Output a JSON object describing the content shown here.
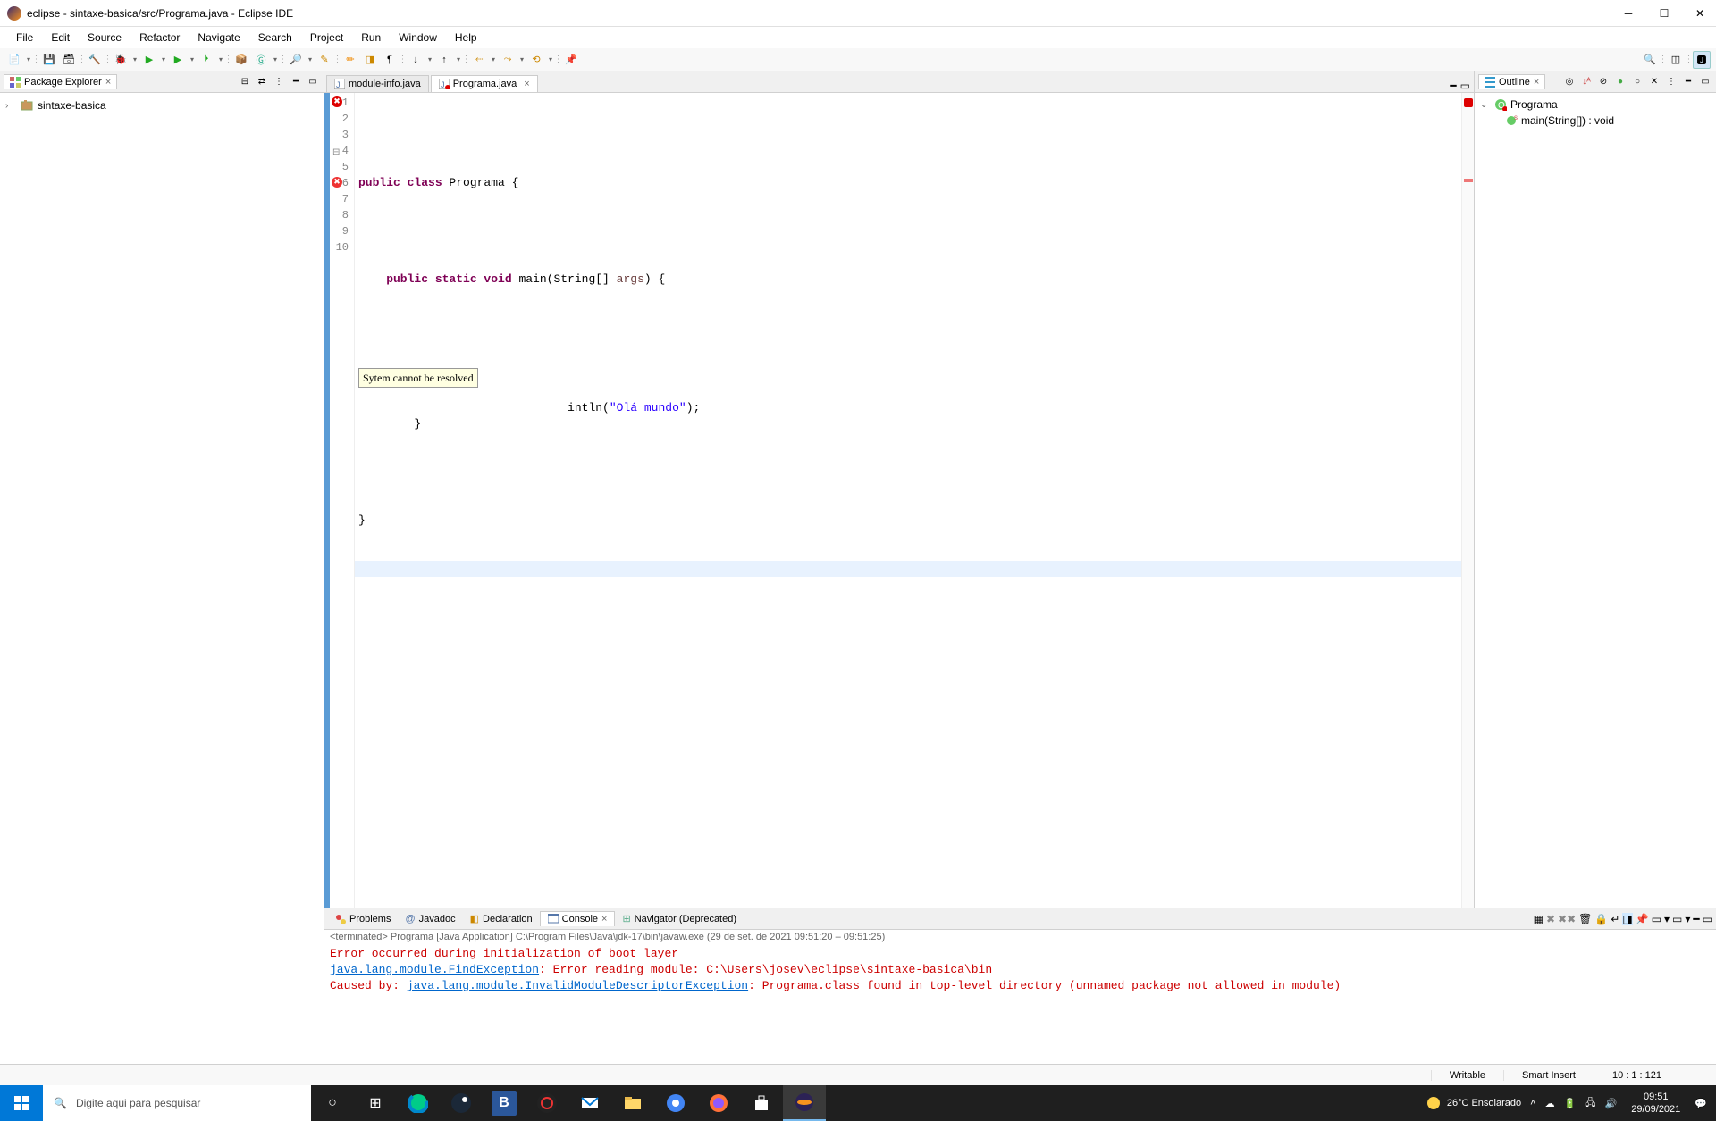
{
  "window": {
    "title": "eclipse - sintaxe-basica/src/Programa.java - Eclipse IDE"
  },
  "menu": {
    "items": [
      "File",
      "Edit",
      "Source",
      "Refactor",
      "Navigate",
      "Search",
      "Project",
      "Run",
      "Window",
      "Help"
    ]
  },
  "packageExplorer": {
    "title": "Package Explorer",
    "project": "sintaxe-basica"
  },
  "editor": {
    "tabs": [
      {
        "label": "module-info.java",
        "active": false
      },
      {
        "label": "Programa.java",
        "active": true
      }
    ],
    "code": {
      "line1": "",
      "line2_pre": "public class ",
      "line2_class": "Programa",
      "line2_post": " {",
      "line3": "",
      "line4_a": "    public static void",
      "line4_b": " main(String[] ",
      "line4_c": "args",
      "line4_d": ") {",
      "line5": "",
      "line6_tooltip": "Sytem cannot be resolved",
      "line6_after": "intln(",
      "line6_str": "\"Olá mundo\"",
      "line6_end": ");",
      "line7": "        }",
      "line8": "",
      "line9": "}",
      "line10": ""
    },
    "lineNumbers": [
      "1",
      "2",
      "3",
      "4",
      "5",
      "6",
      "7",
      "8",
      "9",
      "10"
    ]
  },
  "outline": {
    "title": "Outline",
    "class": "Programa",
    "method": "main(String[]) : void"
  },
  "bottom": {
    "tabs": {
      "problems": "Problems",
      "javadoc": "Javadoc",
      "declaration": "Declaration",
      "console": "Console",
      "navigator": "Navigator (Deprecated)"
    },
    "consoleMeta": "<terminated> Programa [Java Application] C:\\Program Files\\Java\\jdk-17\\bin\\javaw.exe  (29 de set. de 2021 09:51:20 – 09:51:25)",
    "consoleLines": {
      "l1": "Error occurred during initialization of boot layer",
      "l2a": "java.lang.module.FindException",
      "l2b": ": Error reading module: C:\\Users\\josev\\eclipse\\sintaxe-basica\\bin",
      "l3a": "Caused by: ",
      "l3b": "java.lang.module.InvalidModuleDescriptorException",
      "l3c": ": Programa.class found in top-level directory (unnamed package not allowed in module)"
    }
  },
  "status": {
    "writable": "Writable",
    "insert": "Smart Insert",
    "pos": "10 : 1 : 121"
  },
  "taskbar": {
    "search": "Digite aqui para pesquisar",
    "weather": "26°C  Ensolarado",
    "time": "09:51",
    "date": "29/09/2021"
  }
}
